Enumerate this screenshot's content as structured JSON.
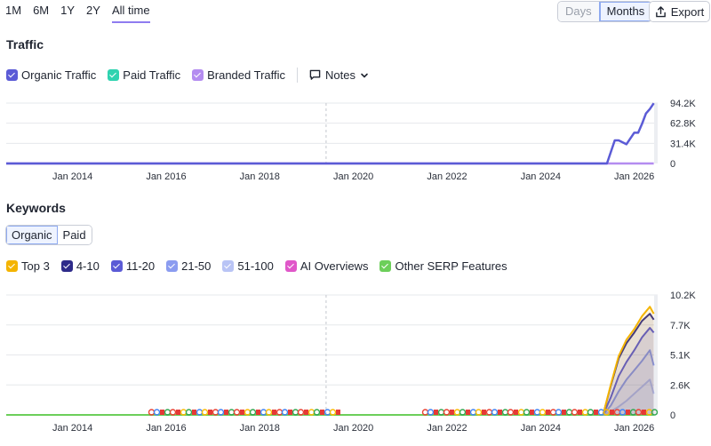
{
  "range": {
    "items": [
      "1M",
      "6M",
      "1Y",
      "2Y",
      "All time"
    ],
    "selected": "All time"
  },
  "granularity": {
    "options": [
      "Days",
      "Months"
    ],
    "selected": "Months"
  },
  "export": {
    "label": "Export",
    "icon": "export-icon"
  },
  "traffic": {
    "title": "Traffic",
    "legend": [
      {
        "label": "Organic Traffic",
        "color": "#5b5bd6",
        "checked": true
      },
      {
        "label": "Paid Traffic",
        "color": "#2fd3b0",
        "checked": true
      },
      {
        "label": "Branded Traffic",
        "color": "#b48cf0",
        "checked": true
      }
    ],
    "notes": {
      "label": "Notes",
      "icon": "notes-icon"
    }
  },
  "keywords": {
    "title": "Keywords",
    "tabs": [
      "Organic",
      "Paid"
    ],
    "selected_tab": "Organic",
    "legend": [
      {
        "label": "Top 3",
        "color": "#f4b400",
        "checked": true
      },
      {
        "label": "4-10",
        "color": "#2e2b8a",
        "checked": true
      },
      {
        "label": "11-20",
        "color": "#5b5bd6",
        "checked": true
      },
      {
        "label": "21-50",
        "color": "#8b9cf0",
        "checked": true
      },
      {
        "label": "51-100",
        "color": "#b9c4f5",
        "checked": true
      },
      {
        "label": "AI Overviews",
        "color": "#e057c9",
        "checked": true
      },
      {
        "label": "Other SERP Features",
        "color": "#6ccf5a",
        "checked": true
      }
    ]
  },
  "chart_data": [
    {
      "type": "line",
      "x_tick_labels": [
        "Jan 2014",
        "Jan 2016",
        "Jan 2018",
        "Jan 2020",
        "Jan 2022",
        "Jan 2024",
        "Jan 2026"
      ],
      "y_tick_labels": [
        "94.2K",
        "62.8K",
        "31.4K",
        "0"
      ],
      "ylim": [
        0,
        94200
      ],
      "xlim": [
        "2012-08",
        "2026-07"
      ],
      "grid": true,
      "series": [
        {
          "name": "Organic Traffic",
          "color": "#5b5bd6",
          "x": [
            "2012-08",
            "2025-06",
            "2025-08",
            "2025-09",
            "2025-11",
            "2026-01",
            "2026-02",
            "2026-03",
            "2026-04",
            "2026-05",
            "2026-06"
          ],
          "y": [
            0,
            0,
            36000,
            36000,
            30000,
            48000,
            48000,
            62000,
            78000,
            85000,
            94000
          ]
        },
        {
          "name": "Branded Traffic",
          "color": "#b48cf0",
          "x": [
            "2012-08",
            "2026-06"
          ],
          "y": [
            0,
            0
          ]
        }
      ]
    },
    {
      "type": "area",
      "x_tick_labels": [
        "Jan 2014",
        "Jan 2016",
        "Jan 2018",
        "Jan 2020",
        "Jan 2022",
        "Jan 2024",
        "Jan 2026"
      ],
      "y_tick_labels": [
        "10.2K",
        "7.7K",
        "5.1K",
        "2.6K",
        "0"
      ],
      "ylim": [
        0,
        10200
      ],
      "xlim": [
        "2012-08",
        "2026-07"
      ],
      "grid": true,
      "series": [
        {
          "name": "Top 3",
          "color": "#f4b400",
          "x": [
            "2025-05",
            "2025-07",
            "2025-09",
            "2025-11",
            "2026-01",
            "2026-03",
            "2026-05",
            "2026-06"
          ],
          "y": [
            0,
            2600,
            5000,
            6400,
            7300,
            8400,
            9200,
            8600
          ]
        },
        {
          "name": "4-10",
          "color": "#2e2b8a",
          "x": [
            "2025-05",
            "2025-07",
            "2025-09",
            "2025-11",
            "2026-01",
            "2026-03",
            "2026-05",
            "2026-06"
          ],
          "y": [
            0,
            2500,
            4800,
            6100,
            7000,
            8000,
            8600,
            8100
          ]
        },
        {
          "name": "11-20",
          "color": "#5b5bd6",
          "x": [
            "2025-05",
            "2025-07",
            "2025-09",
            "2025-11",
            "2026-01",
            "2026-03",
            "2026-05",
            "2026-06"
          ],
          "y": [
            0,
            1500,
            3300,
            4500,
            5500,
            6600,
            7400,
            7000
          ]
        },
        {
          "name": "21-50",
          "color": "#8b9cf0",
          "x": [
            "2025-05",
            "2025-07",
            "2025-09",
            "2025-11",
            "2026-01",
            "2026-03",
            "2026-05",
            "2026-06"
          ],
          "y": [
            0,
            800,
            2000,
            3000,
            3800,
            4600,
            5500,
            4200
          ]
        },
        {
          "name": "51-100",
          "color": "#b9c4f5",
          "x": [
            "2025-05",
            "2025-07",
            "2025-09",
            "2025-11",
            "2026-01",
            "2026-03",
            "2026-05",
            "2026-06"
          ],
          "y": [
            0,
            300,
            700,
            1200,
            1800,
            2400,
            3000,
            1800
          ]
        },
        {
          "name": "Other SERP Features",
          "color": "#6ccf5a",
          "x": [
            "2012-08",
            "2026-06"
          ],
          "y": [
            0,
            0
          ]
        }
      ]
    }
  ]
}
